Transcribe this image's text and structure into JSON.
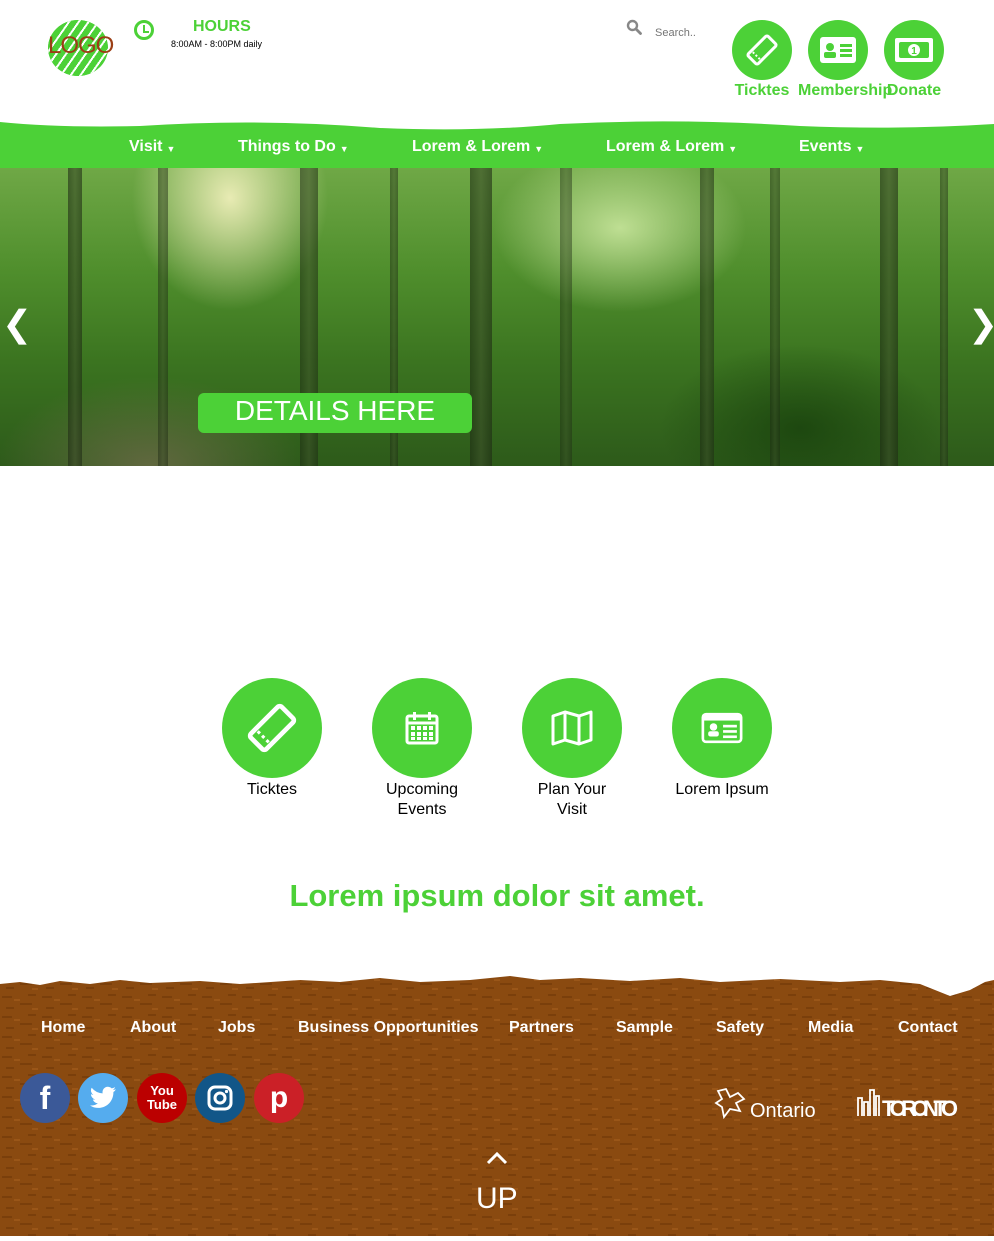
{
  "header": {
    "logo_text": "LOGO",
    "hours_title": "HOURS",
    "hours_text": "8:00AM - 8:00PM daily",
    "search_placeholder": "Search..",
    "buttons": [
      {
        "label": "Ticktes",
        "icon": "ticket-icon"
      },
      {
        "label": "Membership",
        "icon": "membership-card-icon"
      },
      {
        "label": "Donate",
        "icon": "money-icon"
      }
    ]
  },
  "nav": {
    "items": [
      {
        "label": "Visit",
        "caret": "▼"
      },
      {
        "label": "Things to Do",
        "caret": "▼"
      },
      {
        "label": "Lorem & Lorem",
        "caret": "▼"
      },
      {
        "label": "Lorem & Lorem",
        "caret": "▼"
      },
      {
        "label": "Events",
        "caret": "▼"
      }
    ]
  },
  "hero": {
    "prev_arrow": "❮",
    "next_arrow": "❯",
    "cta_label": "DETAILS HERE"
  },
  "features": [
    {
      "label": "Ticktes",
      "icon": "ticket-icon"
    },
    {
      "label": "Upcoming\nEvents",
      "icon": "calendar-icon"
    },
    {
      "label": "Plan Your\nVisit",
      "icon": "map-icon"
    },
    {
      "label": "Lorem Ipsum",
      "icon": "id-card-icon"
    }
  ],
  "tagline": "Lorem ipsum dolor sit amet.",
  "footer": {
    "links": [
      "Home",
      "About",
      "Jobs",
      "Business Opportunities",
      "Partners",
      "Sample",
      "Safety",
      "Media",
      "Contact"
    ],
    "social": [
      {
        "name": "facebook-icon",
        "glyph": "f",
        "color": "#3b5998"
      },
      {
        "name": "twitter-icon",
        "glyph": "",
        "color": "#55acee"
      },
      {
        "name": "youtube-icon",
        "glyph": "You\nTube",
        "color": "#b00"
      },
      {
        "name": "instagram-icon",
        "glyph": "",
        "color": "#125688"
      },
      {
        "name": "pinterest-icon",
        "glyph": "p",
        "color": "#cb2027"
      }
    ],
    "ontario_label": "Ontario",
    "toronto_label": "TORONTO",
    "up_label": "UP"
  },
  "colors": {
    "brand_green": "#4cd137",
    "footer_brown": "#8a4a10",
    "logo_text": "#9b3e15"
  }
}
